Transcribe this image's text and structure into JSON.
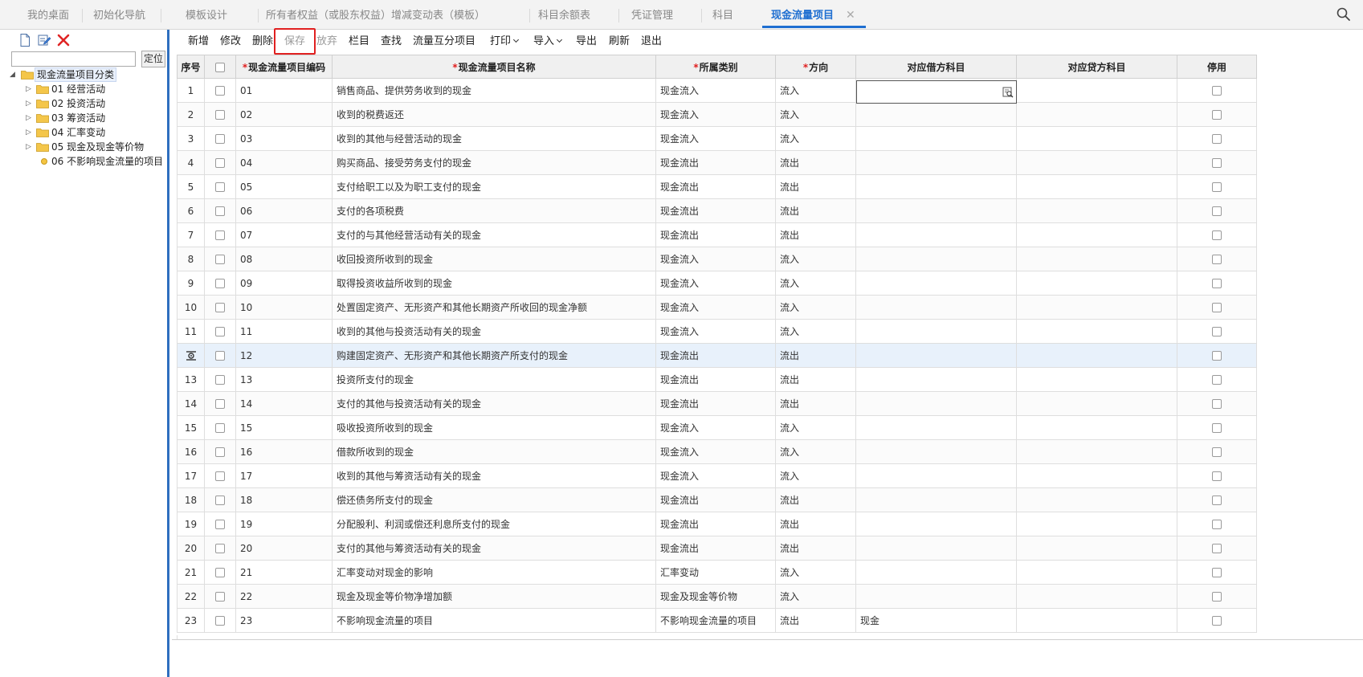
{
  "tabs": [
    {
      "label": "我的桌面",
      "active": false
    },
    {
      "label": "初始化导航",
      "active": false
    },
    {
      "label": "模板设计",
      "active": false
    },
    {
      "label": "所有者权益（或股东权益）增减变动表（模板）",
      "active": false
    },
    {
      "label": "科目余额表",
      "active": false
    },
    {
      "label": "凭证管理",
      "active": false
    },
    {
      "label": "科目",
      "active": false
    },
    {
      "label": "现金流量项目",
      "active": true
    }
  ],
  "tab_close_glyph": "✕",
  "icons": {
    "top_search": "search-icon",
    "left_new": "new-doc-icon",
    "left_edit": "edit-icon",
    "left_delete": "delete-icon",
    "lookup": "lookup-icon",
    "row_marker": "gear-icon"
  },
  "left": {
    "search_value": "",
    "locate_label": "定位",
    "tree": {
      "root": "现金流量项目分类",
      "children": [
        {
          "label": "01 经营活动",
          "type": "folder"
        },
        {
          "label": "02 投资活动",
          "type": "folder"
        },
        {
          "label": "03 筹资活动",
          "type": "folder"
        },
        {
          "label": "04 汇率变动",
          "type": "folder"
        },
        {
          "label": "05 现金及现金等价物",
          "type": "folder"
        },
        {
          "label": "06 不影响现金流量的项目",
          "type": "leaf"
        }
      ]
    }
  },
  "toolbar": {
    "add": "新增",
    "edit": "修改",
    "delete": "删除",
    "save": "保存",
    "discard": "放弃",
    "columns": "栏目",
    "find": "查找",
    "complement": "流量互分项目",
    "print": "打印",
    "import": "导入",
    "export": "导出",
    "refresh": "刷新",
    "exit": "退出"
  },
  "grid": {
    "headers": {
      "seq": "序号",
      "code": "现金流量项目编码",
      "name": "现金流量项目名称",
      "category": "所属类别",
      "direction": "方向",
      "debit": "对应借方科目",
      "credit": "对应贷方科目",
      "stop": "停用"
    },
    "required_mark": "*",
    "selected_row": 12,
    "rows": [
      {
        "seq": "1",
        "code": "01",
        "name": "销售商品、提供劳务收到的现金",
        "category": "现金流入",
        "direction": "流入",
        "debit": "",
        "credit": ""
      },
      {
        "seq": "2",
        "code": "02",
        "name": "收到的税费返还",
        "category": "现金流入",
        "direction": "流入",
        "debit": "",
        "credit": ""
      },
      {
        "seq": "3",
        "code": "03",
        "name": "收到的其他与经营活动的现金",
        "category": "现金流入",
        "direction": "流入",
        "debit": "",
        "credit": ""
      },
      {
        "seq": "4",
        "code": "04",
        "name": "购买商品、接受劳务支付的现金",
        "category": "现金流出",
        "direction": "流出",
        "debit": "",
        "credit": ""
      },
      {
        "seq": "5",
        "code": "05",
        "name": "支付给职工以及为职工支付的现金",
        "category": "现金流出",
        "direction": "流出",
        "debit": "",
        "credit": ""
      },
      {
        "seq": "6",
        "code": "06",
        "name": "支付的各项税费",
        "category": "现金流出",
        "direction": "流出",
        "debit": "",
        "credit": ""
      },
      {
        "seq": "7",
        "code": "07",
        "name": "支付的与其他经营活动有关的现金",
        "category": "现金流出",
        "direction": "流出",
        "debit": "",
        "credit": ""
      },
      {
        "seq": "8",
        "code": "08",
        "name": "收回投资所收到的现金",
        "category": "现金流入",
        "direction": "流入",
        "debit": "",
        "credit": ""
      },
      {
        "seq": "9",
        "code": "09",
        "name": "取得投资收益所收到的现金",
        "category": "现金流入",
        "direction": "流入",
        "debit": "",
        "credit": ""
      },
      {
        "seq": "10",
        "code": "10",
        "name": "处置固定资产、无形资产和其他长期资产所收回的现金净额",
        "category": "现金流入",
        "direction": "流入",
        "debit": "",
        "credit": ""
      },
      {
        "seq": "11",
        "code": "11",
        "name": "收到的其他与投资活动有关的现金",
        "category": "现金流入",
        "direction": "流入",
        "debit": "",
        "credit": ""
      },
      {
        "seq": "12",
        "code": "12",
        "name": "购建固定资产、无形资产和其他长期资产所支付的现金",
        "category": "现金流出",
        "direction": "流出",
        "debit": "",
        "credit": ""
      },
      {
        "seq": "13",
        "code": "13",
        "name": "投资所支付的现金",
        "category": "现金流出",
        "direction": "流出",
        "debit": "",
        "credit": ""
      },
      {
        "seq": "14",
        "code": "14",
        "name": "支付的其他与投资活动有关的现金",
        "category": "现金流出",
        "direction": "流出",
        "debit": "",
        "credit": ""
      },
      {
        "seq": "15",
        "code": "15",
        "name": "吸收投资所收到的现金",
        "category": "现金流入",
        "direction": "流入",
        "debit": "",
        "credit": ""
      },
      {
        "seq": "16",
        "code": "16",
        "name": "借款所收到的现金",
        "category": "现金流入",
        "direction": "流入",
        "debit": "",
        "credit": ""
      },
      {
        "seq": "17",
        "code": "17",
        "name": "收到的其他与筹资活动有关的现金",
        "category": "现金流入",
        "direction": "流入",
        "debit": "",
        "credit": ""
      },
      {
        "seq": "18",
        "code": "18",
        "name": "偿还债务所支付的现金",
        "category": "现金流出",
        "direction": "流出",
        "debit": "",
        "credit": ""
      },
      {
        "seq": "19",
        "code": "19",
        "name": "分配股利、利润或偿还利息所支付的现金",
        "category": "现金流出",
        "direction": "流出",
        "debit": "",
        "credit": ""
      },
      {
        "seq": "20",
        "code": "20",
        "name": "支付的其他与筹资活动有关的现金",
        "category": "现金流出",
        "direction": "流出",
        "debit": "",
        "credit": ""
      },
      {
        "seq": "21",
        "code": "21",
        "name": "汇率变动对现金的影响",
        "category": "汇率变动",
        "direction": "流入",
        "debit": "",
        "credit": ""
      },
      {
        "seq": "22",
        "code": "22",
        "name": "现金及现金等价物净增加额",
        "category": "现金及现金等价物",
        "direction": "流入",
        "debit": "",
        "credit": ""
      },
      {
        "seq": "23",
        "code": "23",
        "name": "不影响现金流量的项目",
        "category": "不影响现金流量的项目",
        "direction": "流出",
        "debit": "现金",
        "credit": ""
      }
    ]
  }
}
